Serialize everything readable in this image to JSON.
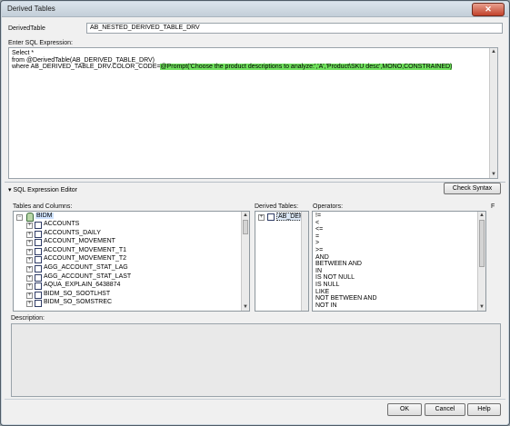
{
  "window": {
    "title": "Derived Tables",
    "close_glyph": "✕"
  },
  "derived_table": {
    "label": "DerivedTable",
    "value": "AB_NESTED_DERIVED_TABLE_DRV"
  },
  "sql": {
    "label": "Enter SQL Expression:",
    "line1": "Select *",
    "line2": "from @DerivedTable(AB_DERIVED_TABLE_DRV)",
    "line3_prefix": "where AB_DERIVED_TABLE_DRV.COLOR_CODE=",
    "line3_highlight": "@Prompt('Choose the product descriptions to analyze:','A','Product\\SKU desc',MONO,CONSTRAINED)"
  },
  "editor": {
    "toggle_label": "▾ SQL Expression Editor",
    "check_syntax_label": "Check Syntax"
  },
  "tables": {
    "label": "Tables and Columns:",
    "root": "BIDM",
    "items": [
      "ACCOUNTS",
      "ACCOUNTS_DAILY",
      "ACCOUNT_MOVEMENT",
      "ACCOUNT_MOVEMENT_T1",
      "ACCOUNT_MOVEMENT_T2",
      "AGG_ACCOUNT_STAT_LAG",
      "AGG_ACCOUNT_STAT_LAST",
      "AQUA_EXPLAIN_6438874",
      "BIDM_SO_SOOTLHST",
      "BIDM_SO_SOMSTREC"
    ]
  },
  "derived_tables": {
    "label": "Derived Tables:",
    "items": [
      "AB_DERIVED_"
    ]
  },
  "operators": {
    "label": "Operators:",
    "items": [
      "!=",
      "<",
      "<=",
      "=",
      ">",
      ">=",
      "AND",
      "BETWEEN  AND",
      "IN",
      "IS NOT NULL",
      "IS NULL",
      "LIKE",
      "NOT BETWEEN  AND",
      "NOT IN"
    ],
    "side_label": "F"
  },
  "description": {
    "label": "Description:"
  },
  "buttons": {
    "ok": "OK",
    "cancel": "Cancel",
    "help": "Help"
  }
}
